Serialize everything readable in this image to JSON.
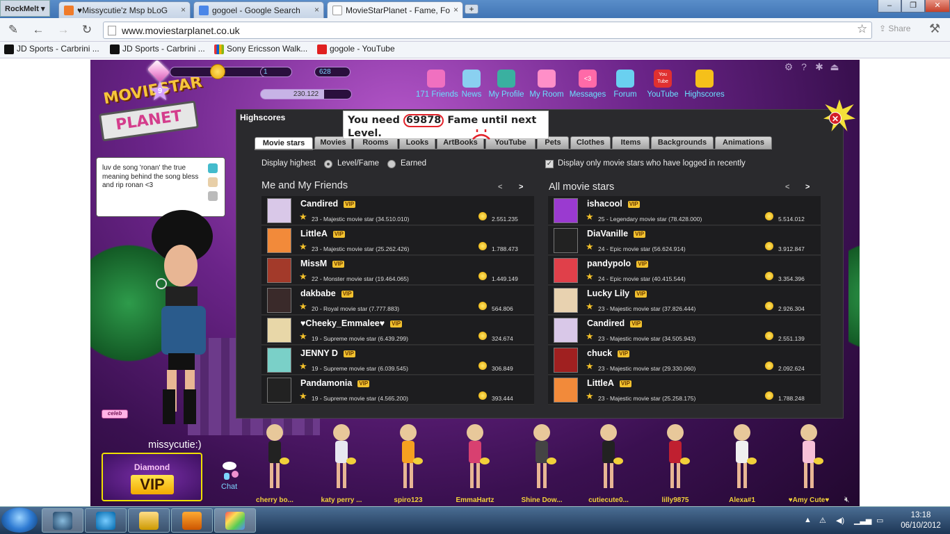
{
  "browser": {
    "rockmelt": "RockMelt ▾",
    "tabs": [
      {
        "title": "♥Missycutie'z Msp bLoG",
        "color": "#f07b2a"
      },
      {
        "title": "gogoel - Google Search",
        "color": "#4a86e8"
      },
      {
        "title": "MovieStarPlanet - Fame, Fo",
        "color": "#888888"
      }
    ],
    "newtab": "+",
    "win_min": "–",
    "win_max": "❐",
    "win_close": "✕",
    "url": "www.moviestarplanet.co.uk",
    "share": "Share",
    "bookmarks": [
      {
        "label": "JD Sports - Carbrini ...",
        "icon": "jd-icon"
      },
      {
        "label": "JD Sports - Carbrini ...",
        "icon": "jd-icon"
      },
      {
        "label": "Sony Ericsson Walk...",
        "icon": "ebay-icon"
      },
      {
        "label": "gogole - YouTube",
        "icon": "youtube-icon"
      }
    ]
  },
  "hud": {
    "diamonds": "1",
    "coins": "628",
    "level": "9",
    "fame": "230.122"
  },
  "topnav": [
    {
      "label": "171 Friends",
      "icon": "friends-icon",
      "color": "#f070c0"
    },
    {
      "label": "News",
      "icon": "news-icon",
      "color": "#8ad0f0"
    },
    {
      "label": "My Profile",
      "icon": "profile-icon",
      "color": "#3ab0a0"
    },
    {
      "label": "My Room",
      "icon": "room-icon",
      "color": "#ff8fc8"
    },
    {
      "label": "Messages",
      "icon": "messages-icon",
      "color": "#ff6aa8"
    },
    {
      "label": "Forum",
      "icon": "forum-icon",
      "color": "#6ad0f0"
    },
    {
      "label": "YouTube",
      "icon": "youtube-icon",
      "color": "#e03030"
    },
    {
      "label": "Highscores",
      "icon": "trophy-icon",
      "color": "#f5c01a"
    }
  ],
  "messages_badge": "<3",
  "youtube_badge": "You Tube",
  "panel": {
    "title": "Highscores",
    "tooltip_pre": "You need ",
    "tooltip_num": "69878",
    "tooltip_post": " Fame until next Level.",
    "tabs": [
      "Movie stars",
      "Movies",
      "Rooms",
      "Looks",
      "ArtBooks",
      "YouTube",
      "Pets",
      "Clothes",
      "Items",
      "Backgrounds",
      "Animations"
    ],
    "display_highest": "Display highest",
    "opt_levelfame": "Level/Fame",
    "opt_earned": "Earned",
    "checkbox_label": "Display only movie stars who have logged in recently",
    "left_heading": "Me and My Friends",
    "right_heading": "All movie stars",
    "pager_prev": "<",
    "pager_next": ">",
    "vip_label": "VIP",
    "left_rows": [
      {
        "name": "Candired",
        "desc": "23 - Majestic movie star (34.510.010)",
        "fame": "2.551.235",
        "avatar": "#d9c8e8"
      },
      {
        "name": "LittleA",
        "desc": "23 - Majestic movie star (25.262.426)",
        "fame": "1.788.473",
        "avatar": "#f28a3a"
      },
      {
        "name": "MissM",
        "desc": "22 - Monster movie star (19.464.065)",
        "fame": "1.449.149",
        "avatar": "#a33a2a"
      },
      {
        "name": "dakbabe",
        "desc": "20 - Royal movie star (7.777.883)",
        "fame": "564.806",
        "avatar": "#3a2a2a"
      },
      {
        "name": "♥Cheeky_Emmalee♥",
        "desc": "19 - Supreme movie star (6.439.299)",
        "fame": "324.674",
        "avatar": "#e8d7a8"
      },
      {
        "name": "JENNY D",
        "desc": "19 - Supreme movie star (6.039.545)",
        "fame": "306.849",
        "avatar": "#7ad0c8"
      },
      {
        "name": "Pandamonia",
        "desc": "19 - Supreme movie star (4.565.200)",
        "fame": "393.444",
        "avatar": "#222222"
      }
    ],
    "right_rows": [
      {
        "name": "ishacool",
        "desc": "25 - Legendary movie star (78.428.000)",
        "fame": "5.514.012",
        "avatar": "#9a3ad0"
      },
      {
        "name": "DiaVanille",
        "desc": "24 - Epic movie star (56.624.914)",
        "fame": "3.912.847",
        "avatar": "#222222"
      },
      {
        "name": "pandypolo",
        "desc": "24 - Epic movie star (40.415.544)",
        "fame": "3.354.396",
        "avatar": "#e0404a"
      },
      {
        "name": "Lucky Lily",
        "desc": "23 - Majestic movie star (37.826.444)",
        "fame": "2.926.304",
        "avatar": "#e8d2b0"
      },
      {
        "name": "Candired",
        "desc": "23 - Majestic movie star (34.505.943)",
        "fame": "2.551.139",
        "avatar": "#d9c8e8"
      },
      {
        "name": "chuck",
        "desc": "23 - Majestic movie star (29.330.060)",
        "fame": "2.092.624",
        "avatar": "#a02020"
      },
      {
        "name": "LittleA",
        "desc": "23 - Majestic movie star (25.258.175)",
        "fame": "1.788.248",
        "avatar": "#f28a3a"
      }
    ]
  },
  "bubble": "luv de song 'ronan' the true meaning behind the song bless and rip ronan <3",
  "celeb": "celeb",
  "username": "missycutie:)",
  "vip_box": {
    "top": "Diamond",
    "main": "VIP"
  },
  "chat_label": "Chat",
  "friends": [
    {
      "name": "cherry bo...",
      "color": "#222222"
    },
    {
      "name": "katy perry ...",
      "color": "#e8e8f0"
    },
    {
      "name": "spiro123",
      "color": "#f5a020"
    },
    {
      "name": "EmmaHartz",
      "color": "#d84070"
    },
    {
      "name": "Shine Dow...",
      "color": "#444444"
    },
    {
      "name": "cutiecute0...",
      "color": "#222222"
    },
    {
      "name": "lilly9875",
      "color": "#c02030"
    },
    {
      "name": "Alexa#1",
      "color": "#f0f0f0"
    },
    {
      "name": "♥Amy Cute♥",
      "color": "#f7c0d8"
    }
  ],
  "taskbar": {
    "time": "13:18",
    "date": "06/10/2012"
  }
}
